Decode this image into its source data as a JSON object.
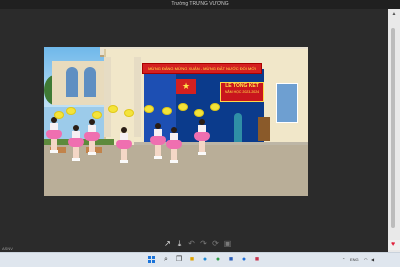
{
  "window": {
    "title": "Trường TRƯNG VƯƠNG"
  },
  "photo": {
    "banner_text": "MỪNG ĐẢNG MỪNG XUÂN - MỪNG ĐẤT NƯỚC ĐỔI MỚI",
    "sign_line1": "LỄ TỔNG KẾT",
    "sign_line2": "NĂM HỌC 2023-2024"
  },
  "toolbar": {
    "left_text": "ASNV",
    "icons": [
      "share-icon",
      "download-icon",
      "undo-icon",
      "redo-icon",
      "rotate-icon",
      "delete-icon"
    ]
  },
  "taskbar": {
    "lang": "ENG",
    "apps": [
      "start-icon",
      "search-icon",
      "task-view-icon",
      "file-explorer-icon",
      "edge-icon",
      "chrome-icon",
      "word-icon",
      "zalo-icon",
      "photos-icon"
    ]
  },
  "colors": {
    "background": "#2b2b2b",
    "titlebar": "#202020",
    "taskbar": "#dfe6ee",
    "accent": "#e0223d"
  }
}
